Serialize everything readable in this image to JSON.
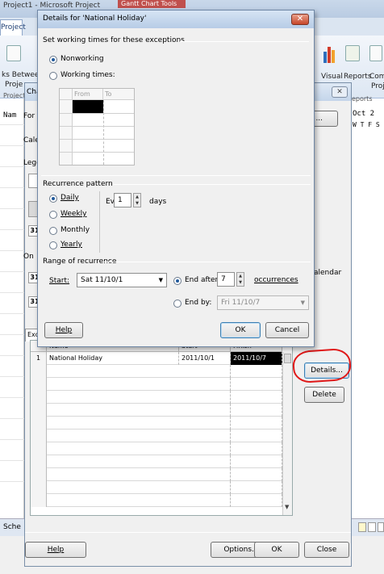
{
  "app": {
    "title": "Project1 - Microsoft Project",
    "context_tab": "Gantt Chart Tools",
    "active_tab": "Project",
    "ribbon": {
      "links_between_label_1": "ks Between",
      "links_between_label_2": "Proje",
      "visual_label": "Visual",
      "reports_label": "Reports",
      "compare_label_1": "Com",
      "compare_label_2": "Proj",
      "group_left": "Project",
      "group_right": "eports"
    },
    "gantt": {
      "col_header": "Nam",
      "timescale_label": "Oct 2",
      "timescale_days": "W T F S"
    },
    "bottom_left_label": "Sche"
  },
  "cwt_dialog": {
    "title": "Chan",
    "for_label": "For g",
    "calendar_label": "Calen",
    "legend_label": "Lege",
    "legend_box_31": "31",
    "on_label": "On",
    "calendar_button": "ndar ...",
    "calendar_note": "alendar",
    "exceptions_tab_label": "Exc",
    "exceptions": {
      "columns": [
        "Name",
        "Start",
        "Finish"
      ],
      "rows": [
        {
          "num": "1",
          "name": "National Holiday",
          "start": "2011/10/1",
          "finish": "2011/10/7"
        }
      ]
    },
    "details_button": "Details...",
    "delete_button": "Delete",
    "help_button": "Help",
    "options_button": "Options...",
    "ok_button": "OK",
    "close_button": "Close"
  },
  "details_dialog": {
    "title": "Details for 'National Holiday'",
    "section_working_times": "Set working times for these exceptions",
    "nonworking_label": "Nonworking",
    "working_times_label": "Working times:",
    "working_grid": {
      "from_header": "From",
      "to_header": "To"
    },
    "recurrence_section": "Recurrence pattern",
    "daily_label": "Daily",
    "weekly_label": "Weekly",
    "monthly_label": "Monthly",
    "yearly_label": "Yearly",
    "every_label": "Every",
    "every_value": "1",
    "days_label": "days",
    "range_section": "Range of recurrence",
    "start_label": "Start:",
    "start_value": "Sat 11/10/1",
    "end_after_label": "End after:",
    "end_after_value": "7",
    "occurrences_label": "occurrences",
    "end_by_label": "End by:",
    "end_by_value": "Fri 11/10/7",
    "help_button": "Help",
    "ok_button": "OK",
    "cancel_button": "Cancel",
    "close_glyph": "✕"
  }
}
